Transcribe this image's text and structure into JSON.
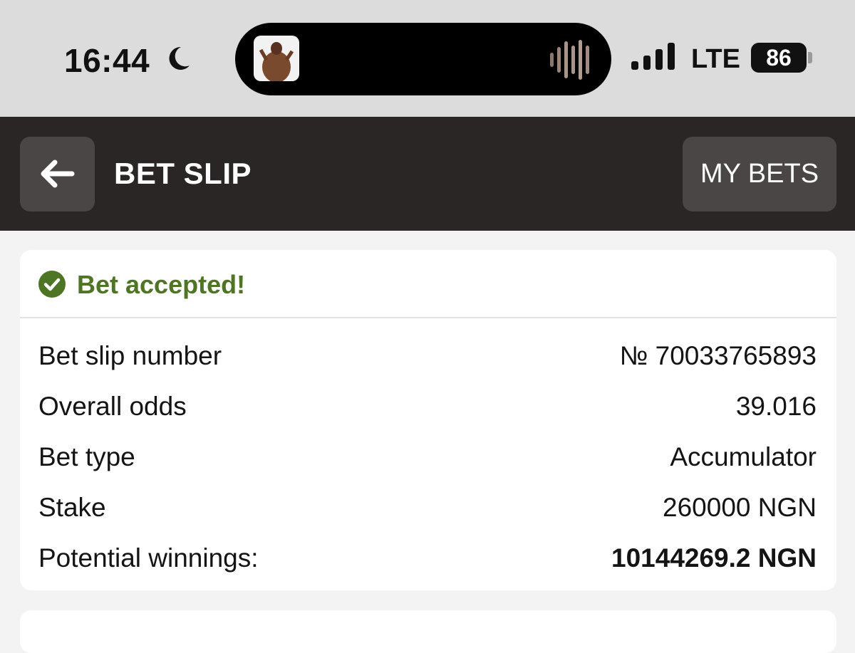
{
  "status_bar": {
    "time": "16:44",
    "network": "LTE",
    "battery": "86",
    "icons": [
      "moon-icon",
      "album-art",
      "waveform-icon",
      "signal-icon",
      "battery-icon"
    ]
  },
  "header": {
    "title": "BET SLIP",
    "my_bets_label": "MY BETS",
    "back_icon": "arrow-left-icon"
  },
  "bet": {
    "status": "Bet accepted!",
    "status_color": "#4e7524",
    "details": [
      {
        "label": "Bet slip number",
        "value": "№ 70033765893"
      },
      {
        "label": "Overall odds",
        "value": "39.016"
      },
      {
        "label": "Bet type",
        "value": "Accumulator"
      },
      {
        "label": "Stake",
        "value": "260000 NGN"
      },
      {
        "label": "Potential winnings:",
        "value": "10144269.2 NGN"
      }
    ]
  },
  "colors": {
    "header_bg": "#2a2626",
    "button_bg": "#4a4646",
    "page_bg": "#f4f3f4"
  }
}
